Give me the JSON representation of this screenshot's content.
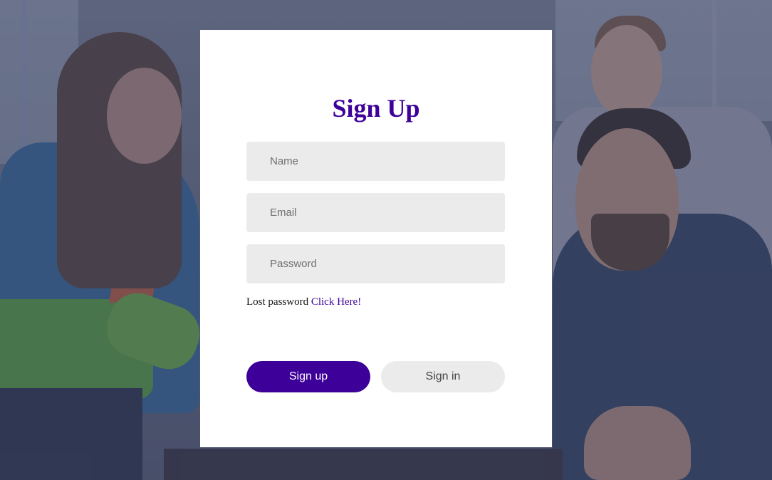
{
  "page": {
    "title": "Sign Up"
  },
  "form": {
    "name": {
      "placeholder": "Name",
      "value": ""
    },
    "email": {
      "placeholder": "Email",
      "value": ""
    },
    "password": {
      "placeholder": "Password",
      "value": ""
    }
  },
  "lost_password": {
    "text": "Lost password",
    "link_label": "Click Here!"
  },
  "buttons": {
    "sign_up": "Sign up",
    "sign_in": "Sign in"
  },
  "colors": {
    "accent": "#3d0099",
    "field_background": "#ebebeb",
    "card_background": "#ffffff"
  }
}
